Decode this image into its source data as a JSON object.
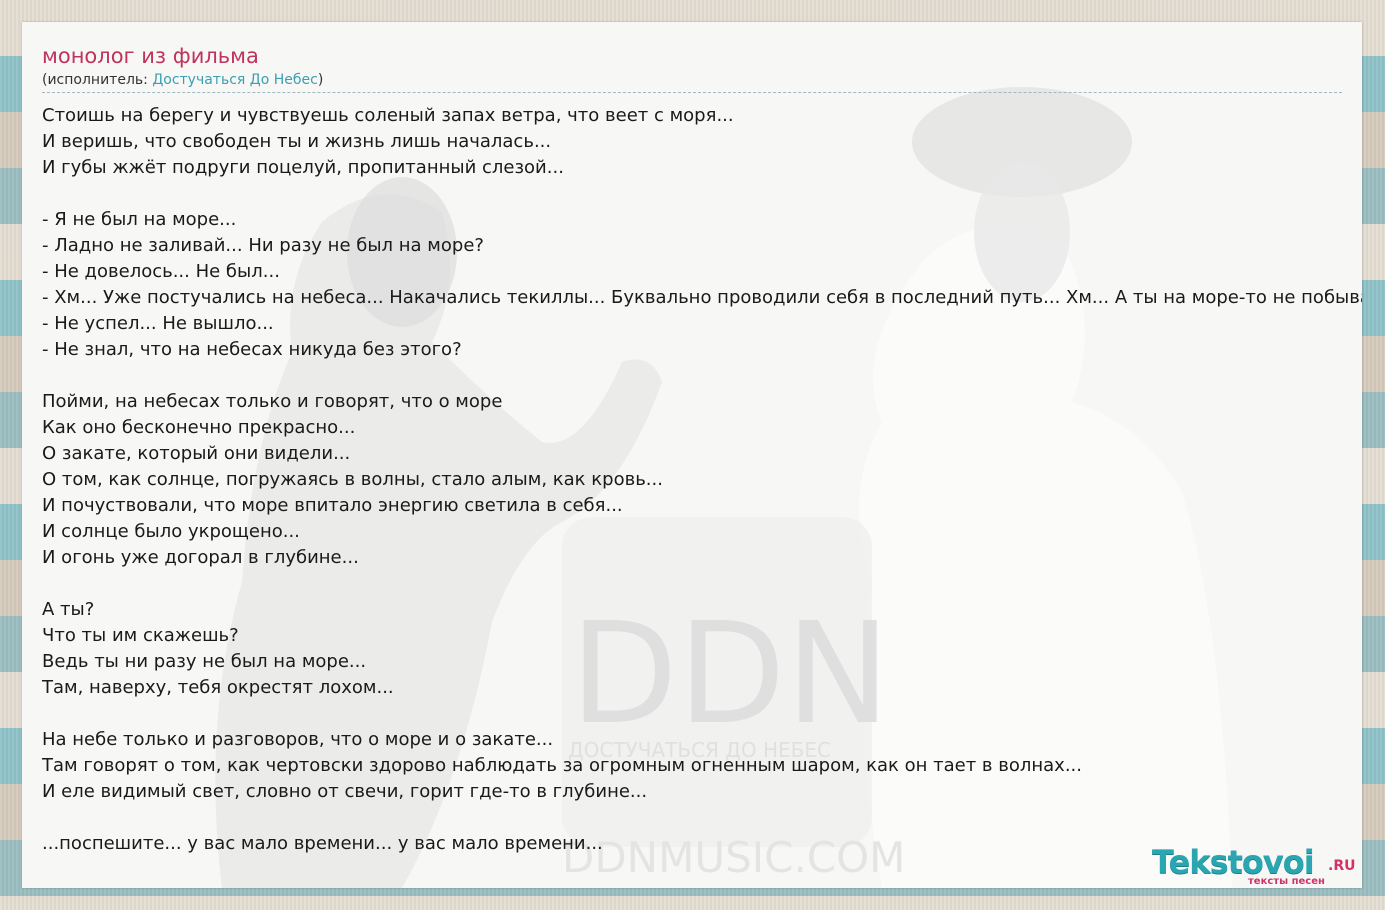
{
  "song": {
    "title": "монолог из фильма",
    "artist_prefix": "(исполнитель: ",
    "artist_name": "Достучаться До Небес",
    "artist_suffix": ")"
  },
  "lyrics": [
    "Стоишь на берегу и чувствуешь соленый запах ветра, что веет с моря...",
    "И веришь, что свободен ты и жизнь лишь началась...",
    "И губы жжёт подруги поцелуй, пропитанный слезой...",
    "",
    "- Я не был на море...",
    "- Ладно не заливай... Ни разу не был на море?",
    "- Не довелось... Не был...",
    "- Хм... Уже постучались на небеса... Накачались текиллы... Буквально проводили себя в последний путь... Хм... А ты на море-то не побывал...",
    "- Не успел... Не вышло...",
    "- Не знал, что на небесах никуда без этого?",
    "",
    "Пойми, на небесах только и говорят, что о море",
    "Как оно бесконечно прекрасно...",
    "О закате, который они видели...",
    "О том, как солнце, погружаясь в волны, стало алым, как кровь...",
    "И почуствовали, что море впитало энергию светила в себя...",
    "И солнце было укрощено...",
    "И огонь уже догорал в глубине...",
    "",
    "А ты?",
    "Что ты им скажешь?",
    "Ведь ты ни разу не был на море...",
    "Там, наверху, тебя окрестят лохом...",
    "",
    "На небе только и разговоров, что о море и о закате...",
    "Там говорят о том, как чертовски здорово наблюдать за огромным огненным шаром, как он тает в волнах...",
    "И еле видимый свет, словно от свечи, горит где-то в глубине...",
    "",
    "...поспешите... у вас мало времени... у вас мало времени..."
  ],
  "background_art": {
    "logo_letters": "DDN",
    "logo_caption": "ДОСТУЧАТЬСЯ ДО НЕБЕС",
    "site_caption": "DDNMUSIC.COM"
  },
  "branding": {
    "name": "Tekstovoi",
    "tld": ".RU",
    "tagline": "тексты песен"
  },
  "colors": {
    "title": "#c0335e",
    "link": "#3a9fb0",
    "logo_main": "#2aa6b1",
    "logo_accent": "#d2316c"
  }
}
